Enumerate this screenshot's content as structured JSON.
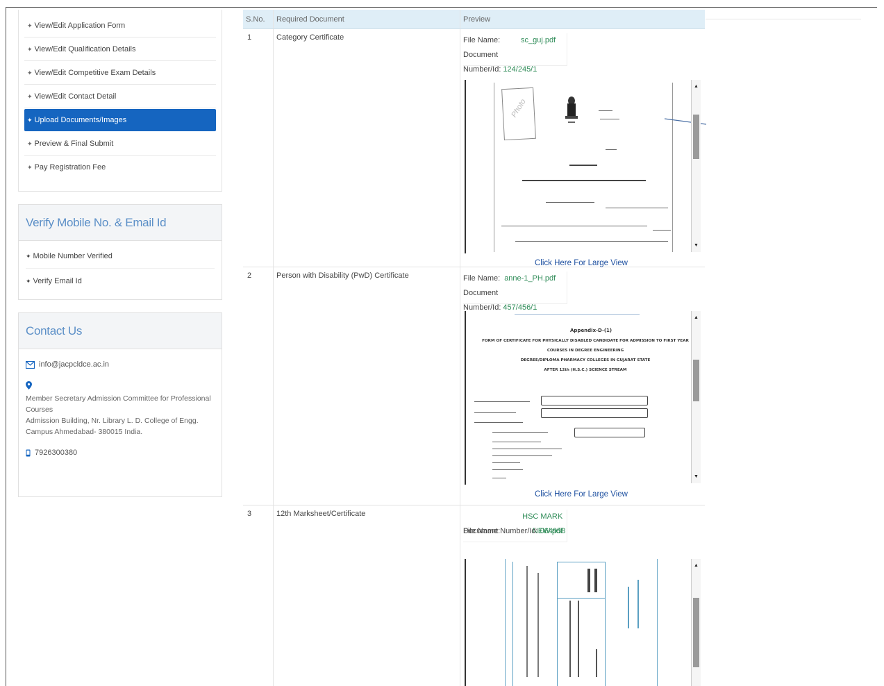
{
  "sidebar": {
    "menu": [
      {
        "label": "View/Edit Application Form"
      },
      {
        "label": "View/Edit Qualification Details"
      },
      {
        "label": "View/Edit Competitive Exam Details"
      },
      {
        "label": "View/Edit Contact Detail"
      },
      {
        "label": "Upload Documents/Images"
      },
      {
        "label": "Preview & Final Submit"
      },
      {
        "label": "Pay Registration Fee"
      }
    ],
    "verify": {
      "title": "Verify Mobile No. & Email Id",
      "items": [
        {
          "label": "Mobile Number Verified"
        },
        {
          "label": "Verify Email Id"
        }
      ]
    },
    "contact": {
      "title": "Contact Us",
      "email": "info@jacpcldce.ac.in",
      "address_line1": "Member Secretary Admission Committee for Professional Courses",
      "address_line2": "Admission Building, Nr. Library L. D. College of Engg.",
      "address_line3": "Campus Ahmedabad- 380015 India.",
      "phone": "7926300380"
    }
  },
  "table": {
    "headers": {
      "sno": "S.No.",
      "doc": "Required Document",
      "preview": "Preview"
    },
    "file_name_label": "File Name:",
    "doc_number_label": "Document Number/Id:",
    "large_view_label": "Click Here For Large View",
    "rows": [
      {
        "sno": "1",
        "doc": "Category Certificate",
        "file_name": "sc_guj.pdf",
        "doc_number": "124/245/1"
      },
      {
        "sno": "2",
        "doc": "Person with Disability (PwD) Certificate",
        "file_name": "anne-1_PH.pdf",
        "doc_number": "457/456/1"
      },
      {
        "sno": "3",
        "doc": "12th Marksheet/Certificate",
        "file_name": "HSC MARK NEW.pdf",
        "doc_number": "064958"
      }
    ]
  },
  "doc_preview": {
    "photo_label": "Photo",
    "pwd_header": "Appendix-D-(1)",
    "pwd_title1": "FORM OF CERTIFICATE FOR PHYSICALLY DISABLED CANDIDATE FOR ADMISSION TO FIRST YEAR",
    "pwd_title2": "COURSES IN DEGREE ENGINEERING",
    "pwd_title3": "DEGREE/DIPLOMA PHARMACY COLLEGES IN GUJARAT STATE",
    "pwd_title4": "AFTER 12th (H.S.C.) SCIENCE STREAM"
  },
  "colors": {
    "accent": "#1565c0",
    "link": "#1e50a0",
    "file_value": "#2e8b57",
    "panel_title": "#5b8fc7"
  }
}
